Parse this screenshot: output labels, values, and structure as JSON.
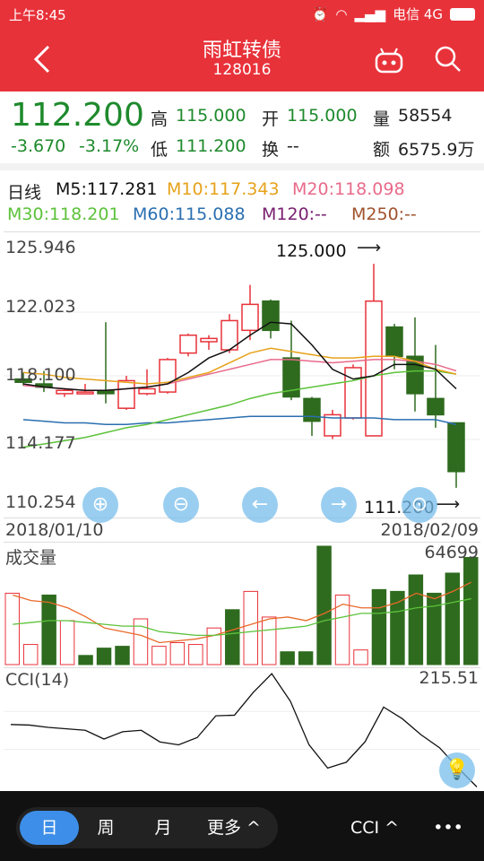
{
  "status_bar": {
    "time": "上午8:45",
    "carrier": "电信 4G"
  },
  "header": {
    "title": "雨虹转债",
    "code": "128016"
  },
  "quote": {
    "price": "112.200",
    "change": "-3.670",
    "change_pct": "-3.17%",
    "high_label": "高",
    "high": "115.000",
    "open_label": "开",
    "open": "115.000",
    "volume_label": "量",
    "volume": "58554",
    "low_label": "低",
    "low": "111.200",
    "turnover_label": "换",
    "turnover": "--",
    "amount_label": "额",
    "amount": "6575.9万"
  },
  "indicators": {
    "period": "日线",
    "m5": "M5:117.281",
    "m10": "M10:117.343",
    "m20": "M20:118.098",
    "m30": "M30:118.201",
    "m60": "M60:115.088",
    "m120": "M120:--",
    "m250": "M250:--"
  },
  "colors": {
    "up": "#e8323a",
    "down": "#2e6b1f",
    "m5": "#111111",
    "m10": "#e6a21a",
    "m20": "#e86a8a",
    "m30": "#5cc23a",
    "m60": "#2a6fb0"
  },
  "kline": {
    "y_labels": [
      "125.946",
      "122.023",
      "118.100",
      "114.177",
      "110.254"
    ],
    "high_marker": "125.000",
    "low_marker": "111.200",
    "start_date": "2018/01/10",
    "end_date": "2018/02/09"
  },
  "chart_data": [
    {
      "type": "candlestick",
      "ylim": [
        110.254,
        125.946
      ],
      "candles": [
        {
          "o": 117.9,
          "c": 117.7,
          "h": 118.3,
          "l": 117.5
        },
        {
          "o": 117.6,
          "c": 117.4,
          "h": 118.4,
          "l": 117.1
        },
        {
          "o": 117.0,
          "c": 117.2,
          "h": 117.3,
          "l": 116.8
        },
        {
          "o": 117.1,
          "c": 117.1,
          "h": 117.6,
          "l": 117.0
        },
        {
          "o": 117.2,
          "c": 117.0,
          "h": 121.4,
          "l": 116.4
        },
        {
          "o": 116.1,
          "c": 117.8,
          "h": 118.1,
          "l": 116.0
        },
        {
          "o": 117.0,
          "c": 117.3,
          "h": 118.5,
          "l": 116.9
        },
        {
          "o": 117.1,
          "c": 119.1,
          "h": 119.2,
          "l": 117.0
        },
        {
          "o": 119.5,
          "c": 120.6,
          "h": 120.7,
          "l": 119.3
        },
        {
          "o": 120.2,
          "c": 120.4,
          "h": 120.6,
          "l": 119.7
        },
        {
          "o": 119.7,
          "c": 121.5,
          "h": 121.9,
          "l": 119.5
        },
        {
          "o": 120.9,
          "c": 122.5,
          "h": 123.7,
          "l": 120.3
        },
        {
          "o": 122.7,
          "c": 120.9,
          "h": 122.8,
          "l": 120.4
        },
        {
          "o": 119.2,
          "c": 116.8,
          "h": 121.5,
          "l": 116.6
        },
        {
          "o": 116.7,
          "c": 115.3,
          "h": 116.8,
          "l": 114.4
        },
        {
          "o": 114.4,
          "c": 115.7,
          "h": 116.0,
          "l": 114.2
        },
        {
          "o": 115.5,
          "c": 118.6,
          "h": 118.8,
          "l": 115.4
        },
        {
          "o": 114.4,
          "c": 122.7,
          "h": 125.0,
          "l": 114.4
        },
        {
          "o": 121.1,
          "c": 119.3,
          "h": 121.3,
          "l": 118.5
        },
        {
          "o": 119.3,
          "c": 117.0,
          "h": 121.7,
          "l": 115.9
        },
        {
          "o": 116.7,
          "c": 115.7,
          "h": 120.0,
          "l": 114.9
        },
        {
          "o": 115.2,
          "c": 112.2,
          "h": 115.2,
          "l": 111.2
        }
      ],
      "ma5": [
        117.6,
        117.4,
        117.3,
        117.2,
        117.2,
        117.3,
        117.4,
        117.6,
        118.3,
        119.2,
        119.7,
        120.6,
        121.4,
        121.3,
        120.0,
        118.5,
        117.9,
        118.1,
        118.8,
        118.8,
        118.5,
        117.3
      ],
      "ma10": [
        118.3,
        118.2,
        118.0,
        117.9,
        117.8,
        117.7,
        117.6,
        117.7,
        118.0,
        118.3,
        118.9,
        119.5,
        119.8,
        119.6,
        119.4,
        119.2,
        119.2,
        119.3,
        119.3,
        119.0,
        118.5,
        118.2
      ],
      "ma20": [
        117.5,
        117.4,
        117.3,
        117.2,
        117.2,
        117.3,
        117.4,
        117.6,
        117.9,
        118.2,
        118.5,
        118.8,
        119.1,
        119.1,
        119.0,
        118.9,
        119.0,
        119.1,
        119.1,
        119.0,
        118.8,
        118.4
      ],
      "ma30": [
        113.7,
        113.9,
        114.1,
        114.3,
        114.6,
        114.9,
        115.1,
        115.4,
        115.7,
        116.0,
        116.3,
        116.7,
        117.0,
        117.2,
        117.4,
        117.6,
        117.8,
        118.1,
        118.3,
        118.4,
        118.4,
        118.2
      ],
      "ma60": [
        115.4,
        115.3,
        115.2,
        115.2,
        115.1,
        115.1,
        115.2,
        115.2,
        115.3,
        115.4,
        115.5,
        115.6,
        115.6,
        115.6,
        115.6,
        115.5,
        115.5,
        115.5,
        115.4,
        115.4,
        115.4,
        115.1
      ]
    },
    {
      "type": "bar",
      "title": "成交量",
      "max_label": "64699",
      "ylim": [
        0,
        64699
      ],
      "values": [
        39000,
        11000,
        38000,
        24000,
        5000,
        9000,
        10000,
        25000,
        10000,
        12000,
        11000,
        20000,
        30000,
        40000,
        26000,
        7000,
        7000,
        64699,
        38000,
        8000,
        41000,
        40000,
        49000,
        39000,
        50000,
        58554
      ],
      "up": [
        true,
        true,
        false,
        true,
        false,
        false,
        false,
        true,
        true,
        true,
        true,
        true,
        false,
        true,
        true,
        false,
        false,
        false,
        true,
        true,
        false,
        false,
        false,
        false,
        false,
        false
      ],
      "ma5": [
        38000,
        35000,
        34000,
        31000,
        26000,
        20000,
        18000,
        16000,
        12000,
        13000,
        14000,
        16000,
        19000,
        22000,
        25000,
        26000,
        24000,
        28000,
        33000,
        31000,
        31000,
        34000,
        39000,
        36000,
        40000,
        45000
      ],
      "ma10": [
        22000,
        23000,
        24000,
        24000,
        23000,
        22000,
        21000,
        21000,
        18000,
        17000,
        16000,
        16000,
        17000,
        18000,
        19000,
        20000,
        21000,
        24000,
        26000,
        28000,
        28000,
        29000,
        31000,
        32000,
        34000,
        36000
      ]
    },
    {
      "type": "line",
      "title": "CCI(14)",
      "max_label": "215.51",
      "ylim": [
        -180,
        215.51
      ],
      "values": [
        40,
        38,
        30,
        25,
        20,
        -10,
        15,
        20,
        -20,
        -30,
        -5,
        70,
        72,
        150,
        215,
        120,
        -30,
        -110,
        -90,
        -20,
        100,
        60,
        5,
        -40,
        -110,
        -175
      ]
    }
  ],
  "volume_panel": {
    "title": "成交量",
    "max": "64699"
  },
  "cci_panel": {
    "title": "CCI(14)",
    "max": "215.51"
  },
  "bottom_bar": {
    "tab_day": "日",
    "tab_week": "周",
    "tab_month": "月",
    "tab_more": "更多 ^",
    "indicator": "CCI ^",
    "menu": "•••"
  }
}
